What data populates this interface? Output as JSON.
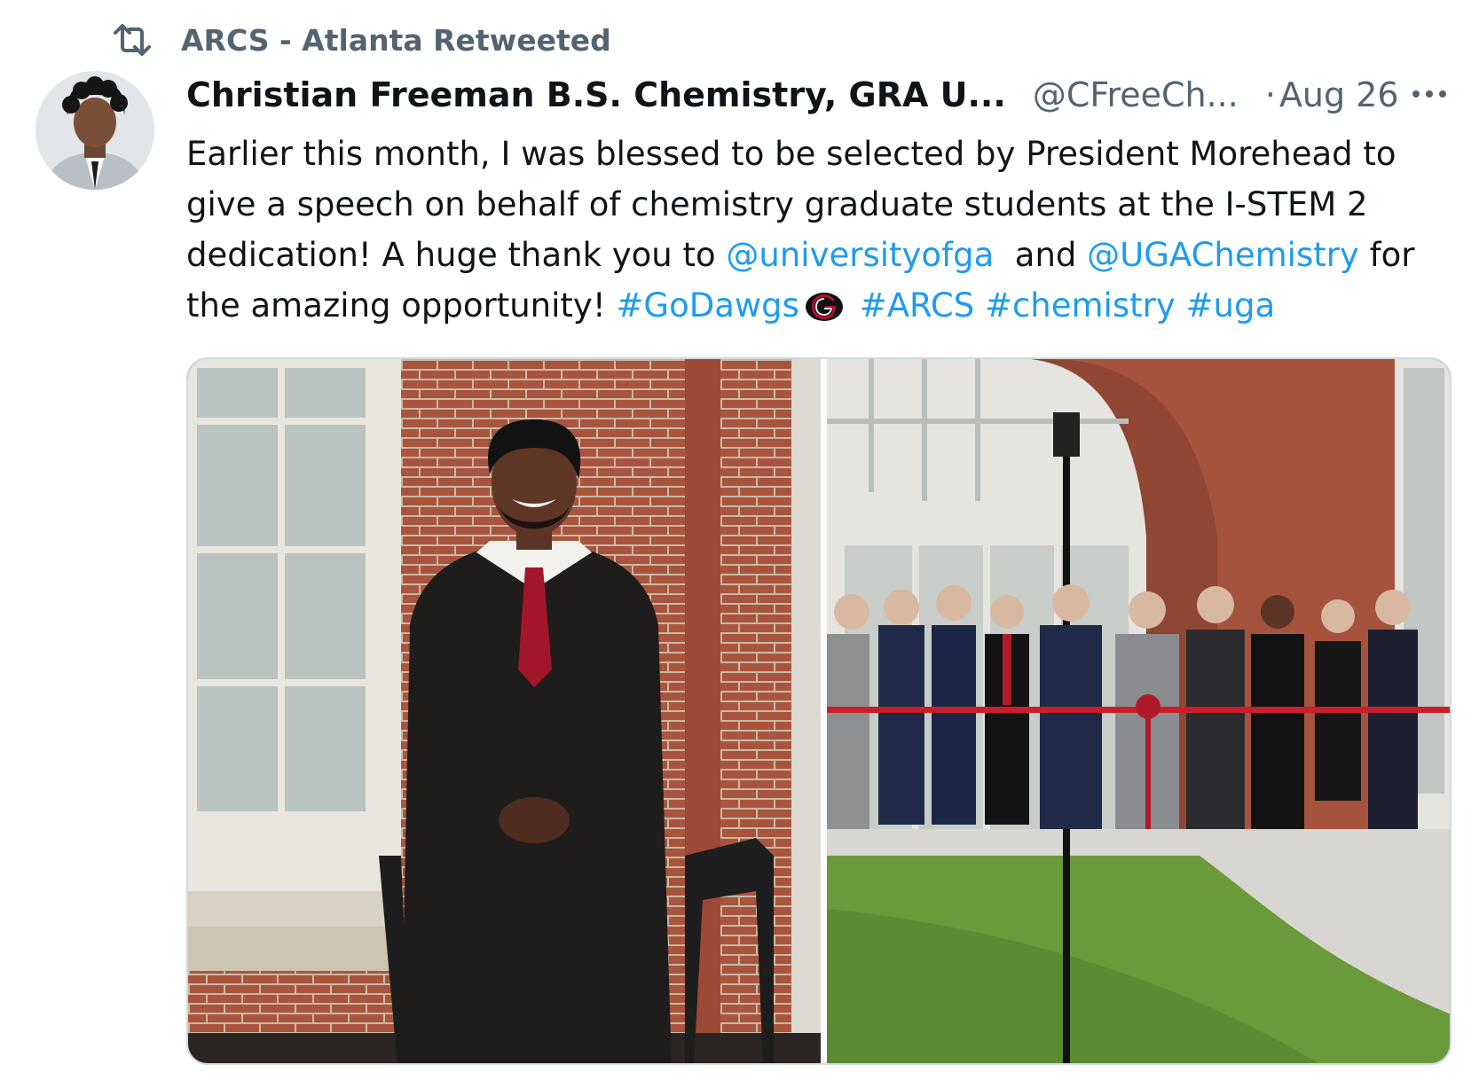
{
  "retweet": {
    "label": "ARCS - Atlanta Retweeted",
    "icon": "retweet-icon"
  },
  "author": {
    "display_name": "Christian Freeman B.S. Chemistry, GRA U...",
    "handle": "@CFreeCh...",
    "separator": "·",
    "date": "Aug 26",
    "avatar_icon": "avatar"
  },
  "more_icon": "more-horizontal-icon",
  "tweet": {
    "l1": "Earlier this month, I was blessed to be selected by President Morehead to",
    "l2": "give a speech on behalf of chemistry graduate students at the I-STEM 2",
    "l3a": "dedication! A huge thank you to ",
    "l3_mention1": "@universityofga",
    "l3b": "  and ",
    "l3_mention2": "@UGAChemistry",
    "l3c": " for",
    "l4a": "the amazing opportunity! ",
    "hashtag1": "#GoDawgs",
    "hashtag2": "#ARCS",
    "hashtag3": "#chemistry",
    "hashtag4": "#uga"
  },
  "colors": {
    "link": "#1d9bf0",
    "secondary_text": "#536471",
    "primary_text": "#0f1419",
    "uga_red": "#ba0c2f"
  },
  "media": {
    "photo1_icon": "photo-man-in-suit",
    "photo2_icon": "photo-ribbon-cutting"
  }
}
